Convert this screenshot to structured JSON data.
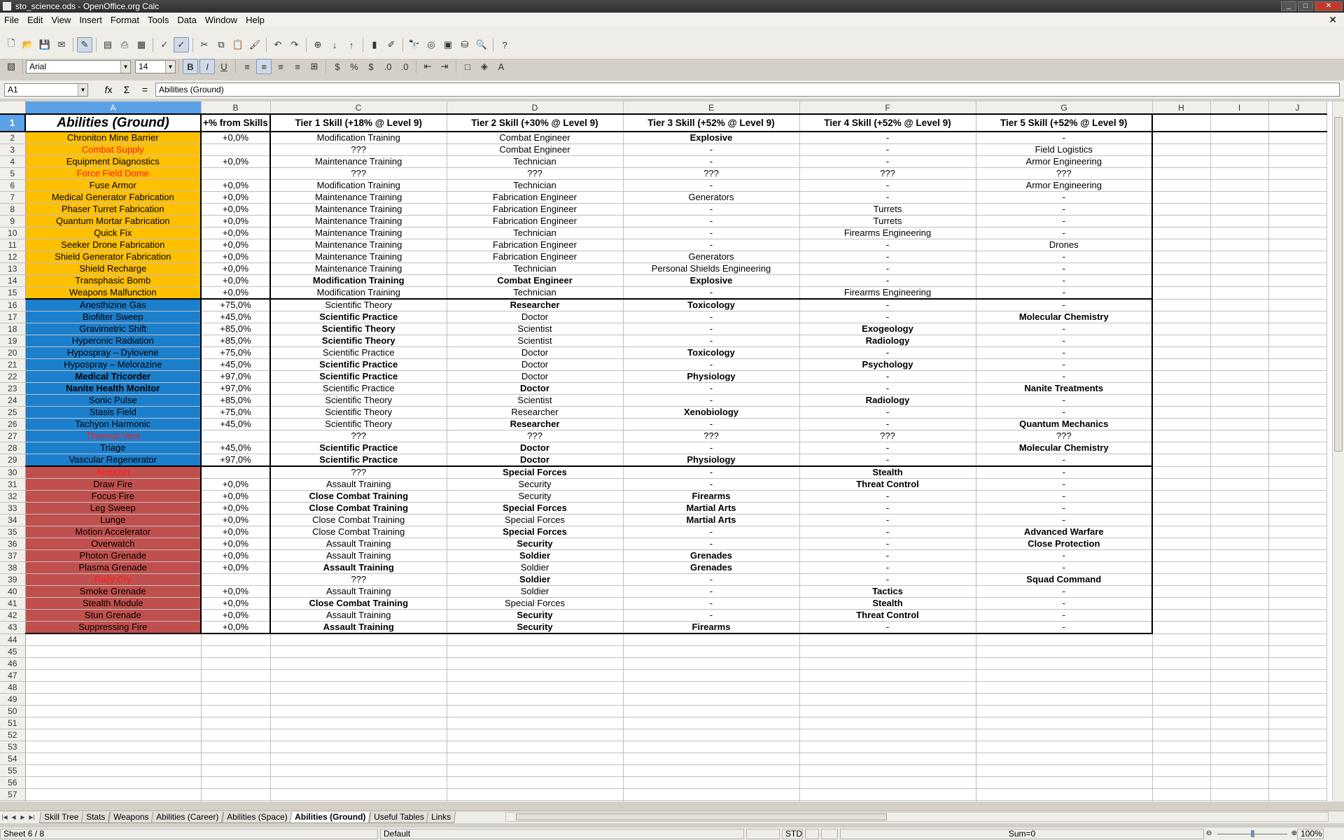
{
  "window": {
    "title": "sto_science.ods - OpenOffice.org Calc"
  },
  "menu": [
    "File",
    "Edit",
    "View",
    "Insert",
    "Format",
    "Tools",
    "Data",
    "Window",
    "Help"
  ],
  "font": {
    "name": "Arial",
    "size": "14"
  },
  "formula": {
    "cell_ref": "A1",
    "content": "Abilities (Ground)"
  },
  "columns": [
    "A",
    "B",
    "C",
    "D",
    "E",
    "F",
    "G",
    "H",
    "I",
    "J"
  ],
  "headers": [
    "Abilities (Ground)",
    "+% from Skills",
    "Tier 1 Skill (+18% @ Level 9)",
    "Tier 2 Skill (+30% @ Level 9)",
    "Tier 3 Skill (+52% @ Level 9)",
    "Tier 4 Skill (+52% @ Level 9)",
    "Tier 5 Skill (+52% @ Level 9)"
  ],
  "rows": [
    {
      "n": "2",
      "c": [
        "Chroniton Mine Barrier",
        "+0,0%",
        "Modification Training",
        "Combat Engineer",
        "Explosive",
        "-",
        "-"
      ],
      "g": "y",
      "b": [
        0,
        0,
        0,
        0,
        1,
        0,
        0
      ]
    },
    {
      "n": "3",
      "c": [
        "Combat Supply",
        "",
        "???",
        "Combat Engineer",
        "-",
        "-",
        "Field Logistics"
      ],
      "g": "y",
      "r": 1,
      "b": [
        0,
        0,
        0,
        0,
        0,
        0,
        0
      ]
    },
    {
      "n": "4",
      "c": [
        "Equipment Diagnostics",
        "+0,0%",
        "Maintenance Training",
        "Technician",
        "-",
        "-",
        "Armor Engineering"
      ],
      "g": "y",
      "b": [
        0,
        0,
        0,
        0,
        0,
        0,
        0
      ]
    },
    {
      "n": "5",
      "c": [
        "Force Field Dome",
        "",
        "???",
        "???",
        "???",
        "???",
        "???"
      ],
      "g": "y",
      "r": 1,
      "b": [
        0,
        0,
        0,
        0,
        0,
        0,
        0
      ]
    },
    {
      "n": "6",
      "c": [
        "Fuse Armor",
        "+0,0%",
        "Modification Training",
        "Technician",
        "-",
        "-",
        "Armor Engineering"
      ],
      "g": "y",
      "b": [
        0,
        0,
        0,
        0,
        0,
        0,
        0
      ]
    },
    {
      "n": "7",
      "c": [
        "Medical Generator Fabrication",
        "+0,0%",
        "Maintenance Training",
        "Fabrication Engineer",
        "Generators",
        "-",
        "-"
      ],
      "g": "y",
      "b": [
        0,
        0,
        0,
        0,
        0,
        0,
        0
      ]
    },
    {
      "n": "8",
      "c": [
        "Phaser Turret Fabrication",
        "+0,0%",
        "Maintenance Training",
        "Fabrication Engineer",
        "-",
        "Turrets",
        "-"
      ],
      "g": "y",
      "b": [
        0,
        0,
        0,
        0,
        0,
        0,
        0
      ]
    },
    {
      "n": "9",
      "c": [
        "Quantum Mortar Fabrication",
        "+0,0%",
        "Maintenance Training",
        "Fabrication Engineer",
        "-",
        "Turrets",
        "-"
      ],
      "g": "y",
      "b": [
        0,
        0,
        0,
        0,
        0,
        0,
        0
      ]
    },
    {
      "n": "10",
      "c": [
        "Quick Fix",
        "+0,0%",
        "Maintenance Training",
        "Technician",
        "-",
        "Firearms Engineering",
        "-"
      ],
      "g": "y",
      "b": [
        0,
        0,
        0,
        0,
        0,
        0,
        0
      ]
    },
    {
      "n": "11",
      "c": [
        "Seeker Drone Fabrication",
        "+0,0%",
        "Maintenance Training",
        "Fabrication Engineer",
        "-",
        "-",
        "Drones"
      ],
      "g": "y",
      "b": [
        0,
        0,
        0,
        0,
        0,
        0,
        0
      ]
    },
    {
      "n": "12",
      "c": [
        "Shield Generator Fabrication",
        "+0,0%",
        "Maintenance Training",
        "Fabrication Engineer",
        "Generators",
        "-",
        "-"
      ],
      "g": "y",
      "b": [
        0,
        0,
        0,
        0,
        0,
        0,
        0
      ]
    },
    {
      "n": "13",
      "c": [
        "Shield Recharge",
        "+0,0%",
        "Maintenance Training",
        "Technician",
        "Personal Shields Engineering",
        "-",
        "-"
      ],
      "g": "y",
      "b": [
        0,
        0,
        0,
        0,
        0,
        0,
        0
      ]
    },
    {
      "n": "14",
      "c": [
        "Transphasic Bomb",
        "+0,0%",
        "Modification Training",
        "Combat Engineer",
        "Explosive",
        "-",
        "-"
      ],
      "g": "y",
      "b": [
        0,
        0,
        1,
        1,
        1,
        0,
        0
      ]
    },
    {
      "n": "15",
      "c": [
        "Weapons Malfunction",
        "+0,0%",
        "Modification Training",
        "Technician",
        "-",
        "Firearms Engineering",
        "-"
      ],
      "g": "y",
      "b": [
        0,
        0,
        0,
        0,
        0,
        0,
        0
      ]
    },
    {
      "n": "16",
      "c": [
        "Anesthizine Gas",
        "+75,0%",
        "Scientific Theory",
        "Researcher",
        "Toxicology",
        "-",
        "-"
      ],
      "g": "bl",
      "b": [
        0,
        0,
        0,
        1,
        1,
        0,
        0
      ]
    },
    {
      "n": "17",
      "c": [
        "Biofilter Sweep",
        "+45,0%",
        "Scientific Practice",
        "Doctor",
        "-",
        "-",
        "Molecular Chemistry"
      ],
      "g": "bl",
      "b": [
        0,
        0,
        1,
        0,
        0,
        0,
        1
      ]
    },
    {
      "n": "18",
      "c": [
        "Gravimetric Shift",
        "+85,0%",
        "Scientific Theory",
        "Scientist",
        "-",
        "Exogeology",
        "-"
      ],
      "g": "bl",
      "b": [
        0,
        0,
        1,
        0,
        0,
        1,
        0
      ]
    },
    {
      "n": "19",
      "c": [
        "Hyperonic Radiation",
        "+85,0%",
        "Scientific Theory",
        "Scientist",
        "-",
        "Radiology",
        "-"
      ],
      "g": "bl",
      "b": [
        0,
        0,
        1,
        0,
        0,
        1,
        0
      ]
    },
    {
      "n": "20",
      "c": [
        "Hypospray – Dylovene",
        "+75,0%",
        "Scientific Practice",
        "Doctor",
        "Toxicology",
        "-",
        "-"
      ],
      "g": "bl",
      "b": [
        0,
        0,
        0,
        0,
        1,
        0,
        0
      ]
    },
    {
      "n": "21",
      "c": [
        "Hypospray – Melorazine",
        "+45,0%",
        "Scientific Practice",
        "Doctor",
        "-",
        "Psychology",
        "-"
      ],
      "g": "bl",
      "b": [
        0,
        0,
        1,
        0,
        0,
        1,
        0
      ]
    },
    {
      "n": "22",
      "c": [
        "Medical Tricorder",
        "+97,0%",
        "Scientific Practice",
        "Doctor",
        "Physiology",
        "-",
        "-"
      ],
      "g": "bl",
      "b": [
        1,
        0,
        1,
        0,
        1,
        0,
        0
      ]
    },
    {
      "n": "23",
      "c": [
        "Nanite Health Monitor",
        "+97,0%",
        "Scientific Practice",
        "Doctor",
        "-",
        "-",
        "Nanite Treatments"
      ],
      "g": "bl",
      "b": [
        1,
        0,
        0,
        1,
        0,
        0,
        1
      ]
    },
    {
      "n": "24",
      "c": [
        "Sonic Pulse",
        "+85,0%",
        "Scientific Theory",
        "Scientist",
        "-",
        "Radiology",
        "-"
      ],
      "g": "bl",
      "b": [
        0,
        0,
        0,
        0,
        0,
        1,
        0
      ]
    },
    {
      "n": "25",
      "c": [
        "Stasis Field",
        "+75,0%",
        "Scientific Theory",
        "Researcher",
        "Xenobiology",
        "-",
        "-"
      ],
      "g": "bl",
      "b": [
        0,
        0,
        0,
        0,
        1,
        0,
        0
      ]
    },
    {
      "n": "26",
      "c": [
        "Tachyon Harmonic",
        "+45,0%",
        "Scientific Theory",
        "Researcher",
        "-",
        "-",
        "Quantum Mechanics"
      ],
      "g": "bl",
      "b": [
        0,
        0,
        0,
        1,
        0,
        0,
        1
      ]
    },
    {
      "n": "27",
      "c": [
        "Thermal Vent",
        "",
        "???",
        "???",
        "???",
        "???",
        "???"
      ],
      "g": "bl",
      "r": 1,
      "b": [
        0,
        0,
        0,
        0,
        0,
        0,
        0
      ]
    },
    {
      "n": "28",
      "c": [
        "Triage",
        "+45,0%",
        "Scientific Practice",
        "Doctor",
        "-",
        "-",
        "Molecular Chemistry"
      ],
      "g": "bl",
      "b": [
        0,
        0,
        1,
        1,
        0,
        0,
        1
      ]
    },
    {
      "n": "29",
      "c": [
        "Vascular Regenerator",
        "+97,0%",
        "Scientific Practice",
        "Doctor",
        "Physiology",
        "-",
        "-"
      ],
      "g": "bl",
      "b": [
        0,
        0,
        1,
        1,
        1,
        0,
        0
      ]
    },
    {
      "n": "30",
      "c": [
        "Ambush",
        "",
        "???",
        "Special Forces",
        "-",
        "Stealth",
        "-"
      ],
      "g": "rd",
      "r": 1,
      "b": [
        0,
        0,
        0,
        1,
        0,
        1,
        0
      ]
    },
    {
      "n": "31",
      "c": [
        "Draw Fire",
        "+0,0%",
        "Assault Training",
        "Security",
        "-",
        "Threat Control",
        "-"
      ],
      "g": "rd",
      "b": [
        0,
        0,
        0,
        0,
        0,
        1,
        0
      ]
    },
    {
      "n": "32",
      "c": [
        "Focus Fire",
        "+0,0%",
        "Close Combat Training",
        "Security",
        "Firearms",
        "-",
        "-"
      ],
      "g": "rd",
      "b": [
        0,
        0,
        1,
        0,
        1,
        0,
        0
      ]
    },
    {
      "n": "33",
      "c": [
        "Leg Sweep",
        "+0,0%",
        "Close Combat Training",
        "Special Forces",
        "Martial Arts",
        "-",
        "-"
      ],
      "g": "rd",
      "b": [
        0,
        0,
        1,
        1,
        1,
        0,
        0
      ]
    },
    {
      "n": "34",
      "c": [
        "Lunge",
        "+0,0%",
        "Close Combat Training",
        "Special Forces",
        "Martial Arts",
        "-",
        "-"
      ],
      "g": "rd",
      "b": [
        0,
        0,
        0,
        0,
        1,
        0,
        0
      ]
    },
    {
      "n": "35",
      "c": [
        "Motion Accelerator",
        "+0,0%",
        "Close Combat Training",
        "Special Forces",
        "-",
        "-",
        "Advanced Warfare"
      ],
      "g": "rd",
      "b": [
        0,
        0,
        0,
        1,
        0,
        0,
        1
      ]
    },
    {
      "n": "36",
      "c": [
        "Overwatch",
        "+0,0%",
        "Assault Training",
        "Security",
        "-",
        "-",
        "Close Protection"
      ],
      "g": "rd",
      "b": [
        0,
        0,
        0,
        1,
        0,
        0,
        1
      ]
    },
    {
      "n": "37",
      "c": [
        "Photon Grenade",
        "+0,0%",
        "Assault Training",
        "Soldier",
        "Grenades",
        "-",
        "-"
      ],
      "g": "rd",
      "b": [
        0,
        0,
        0,
        1,
        1,
        0,
        0
      ]
    },
    {
      "n": "38",
      "c": [
        "Plasma Grenade",
        "+0,0%",
        "Assault Training",
        "Soldier",
        "Grenades",
        "-",
        "-"
      ],
      "g": "rd",
      "b": [
        0,
        0,
        1,
        0,
        1,
        0,
        0
      ]
    },
    {
      "n": "39",
      "c": [
        "Rally Cry",
        "",
        "???",
        "Soldier",
        "-",
        "-",
        "Squad Command"
      ],
      "g": "rd",
      "r": 1,
      "b": [
        0,
        0,
        0,
        1,
        0,
        0,
        1
      ]
    },
    {
      "n": "40",
      "c": [
        "Smoke Grenade",
        "+0,0%",
        "Assault Training",
        "Soldier",
        "-",
        "Tactics",
        "-"
      ],
      "g": "rd",
      "b": [
        0,
        0,
        0,
        0,
        0,
        1,
        0
      ]
    },
    {
      "n": "41",
      "c": [
        "Stealth Module",
        "+0,0%",
        "Close Combat Training",
        "Special Forces",
        "-",
        "Stealth",
        "-"
      ],
      "g": "rd",
      "b": [
        0,
        0,
        1,
        0,
        0,
        1,
        0
      ]
    },
    {
      "n": "42",
      "c": [
        "Stun Grenade",
        "+0,0%",
        "Assault Training",
        "Security",
        "-",
        "Threat Control",
        "-"
      ],
      "g": "rd",
      "b": [
        0,
        0,
        0,
        1,
        0,
        1,
        0
      ]
    },
    {
      "n": "43",
      "c": [
        "Suppressing Fire",
        "+0,0%",
        "Assault Training",
        "Security",
        "Firearms",
        "-",
        "-"
      ],
      "g": "rd",
      "b": [
        0,
        0,
        1,
        1,
        1,
        0,
        0
      ]
    }
  ],
  "empty_rows": [
    "44",
    "45",
    "46",
    "47",
    "48",
    "49",
    "50",
    "51",
    "52",
    "53",
    "54",
    "55",
    "56",
    "57",
    "58"
  ],
  "tabs": [
    "Skill Tree",
    "Stats",
    "Weapons",
    "Abilities (Career)",
    "Abilities (Space)",
    "Abilities (Ground)",
    "Useful Tables",
    "Links"
  ],
  "active_tab": "Abilities (Ground)",
  "status": {
    "sheet": "Sheet 6 / 8",
    "style": "Default",
    "mode": "STD",
    "sum": "Sum=0",
    "zoom": "100%"
  }
}
